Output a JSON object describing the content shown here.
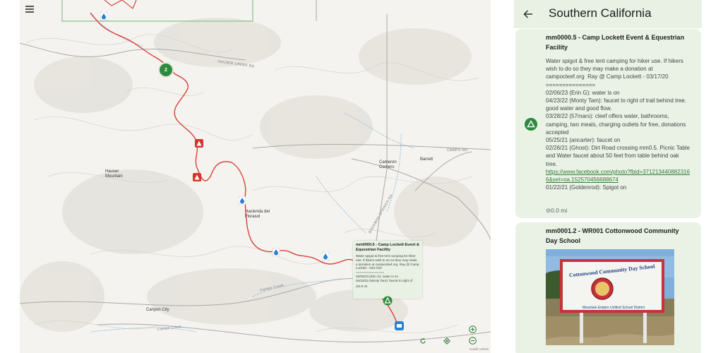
{
  "map": {
    "places": {
      "hauser": "Hauser\nMountain",
      "cameron": "Cameron\nCorners",
      "barrett": "Barrett",
      "hacienda": "Hacienda del\nFlorasol",
      "canyon_city": "Canyon City"
    },
    "roads": {
      "hauser_creek": "HAUSER CREEK RD",
      "campo": "CAMPO RD",
      "campo_creek": "Campo Creek",
      "campo_creek2": "Campo Creek",
      "buckman": "BUCKMAN SPRINGS RD"
    },
    "cluster_count": "2",
    "popup": {
      "title": "mm0000.5 - Camp Lockett Event & Equestrian Facility",
      "desc": "Water spigot & free tent camping for hiker use. If hikers wish to do so they may make a donation at campocleef.org  Ray @ Camp Lockett - 03/17/20\n===============\n02/06/23 (Erin G): water is on\n04/23/22 (Monty Tam): faucet to right of",
      "distance": "0.0 mi"
    },
    "credit": "Credit: USGS"
  },
  "panel": {
    "title": "Southern California",
    "card1": {
      "title": "mm0000.5 - Camp Lockett Event & Equestrian Facility",
      "body": "Water spigot & free tent camping for hiker use. If hikers wish to do so they may make a donation at campocleef.org  Ray @ Camp Lockett - 03/17/20\n===============\n02/06/23 (Erin G): water is on\n04/23/22 (Monty Tam): faucet to right of trail behind tree. good water and good flow.\n03/28/22 (57mars): cleef offers water, bathrooms, camping, two meals, charging outlets for free, donations accepted\n05/25/21 (ancarter): faucet on\n02/26/21 (Ghost): Dirt Road crossing mm0.5. Picnic Table and Water faucet about 50 feet from table behind oak tree.",
      "link": "https://www.facebook.com/photo?fbid=3712134408823166&set=oa.152570456688674",
      "after_link": "01/22/21 (Goldenrod): Spigot on",
      "distance": "0.0 mi"
    },
    "card2": {
      "title": "mm0001.2 - WR001 Cottonwood Community Day School",
      "sign_line1": "Cottonwood Community Day School",
      "sign_line2": "Mountain Empire Unified School District"
    }
  },
  "colors": {
    "trail": "#d9342b",
    "accent_green": "#2e8b3e",
    "card_bg": "#eaf2e6",
    "water_blue": "#2a7fd4"
  }
}
